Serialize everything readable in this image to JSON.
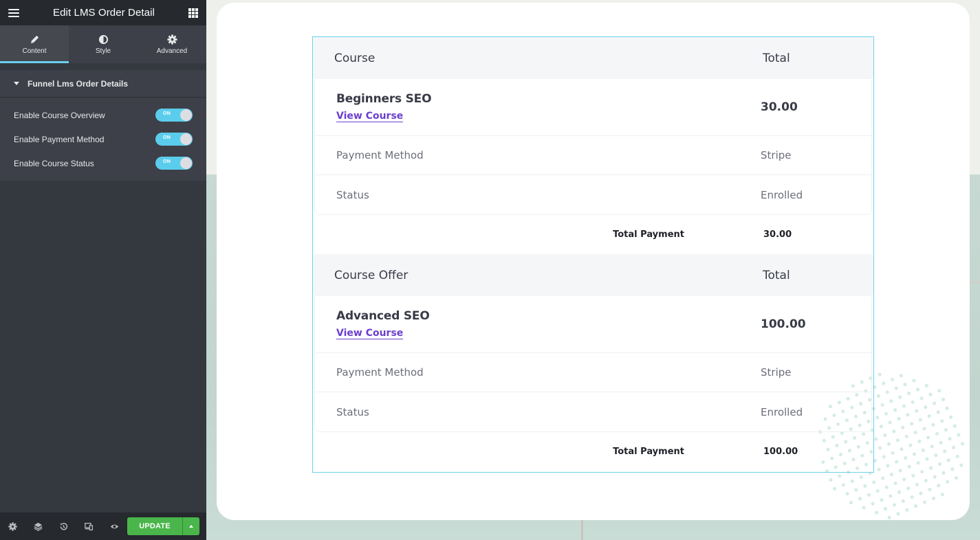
{
  "panel": {
    "title": "Edit LMS Order Detail",
    "tabs": [
      {
        "label": "Content",
        "icon": "pencil-icon",
        "active": true
      },
      {
        "label": "Style",
        "icon": "contrast-icon",
        "active": false
      },
      {
        "label": "Advanced",
        "icon": "gear-icon",
        "active": false
      }
    ],
    "section_title": "Funnel Lms Order Details",
    "controls": [
      {
        "label": "Enable Course Overview",
        "state": "ON"
      },
      {
        "label": "Enable Payment Method",
        "state": "ON"
      },
      {
        "label": "Enable Course Status",
        "state": "ON"
      }
    ],
    "footer": {
      "icons": [
        "settings-icon",
        "layers-icon",
        "history-icon",
        "responsive-icon",
        "preview-eye-icon"
      ],
      "update_label": "UPDATE"
    }
  },
  "colors": {
    "accent": "#6ad0f0",
    "toggle_on": "#5bcdec",
    "update_green": "#4ab54b",
    "link_purple": "#6b3fcf",
    "widget_outline": "#6ad0ec"
  },
  "order": {
    "sections": [
      {
        "header_left": "Course",
        "header_right": "Total",
        "item_name": "Beginners SEO",
        "item_link": "View Course",
        "item_price": "30.00",
        "payment_label": "Payment Method",
        "payment_value": "Stripe",
        "status_label": "Status",
        "status_value": "Enrolled",
        "total_label": "Total Payment",
        "total_value": "30.00"
      },
      {
        "header_left": "Course Offer",
        "header_right": "Total",
        "item_name": "Advanced SEO",
        "item_link": "View Course",
        "item_price": "100.00",
        "payment_label": "Payment Method",
        "payment_value": "Stripe",
        "status_label": "Status",
        "status_value": "Enrolled",
        "total_label": "Total Payment",
        "total_value": "100.00"
      }
    ]
  }
}
